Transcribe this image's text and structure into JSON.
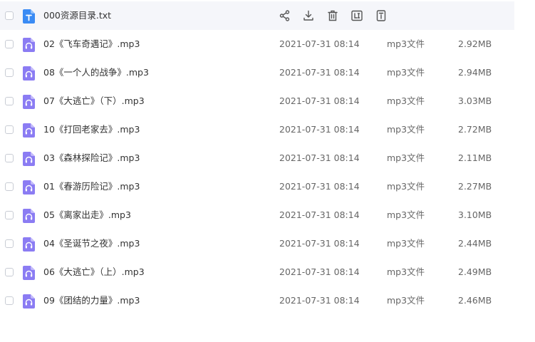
{
  "files": [
    {
      "name": "000资源目录.txt",
      "icon": "txt-file-icon"
    },
    {
      "name": "02《飞车奇遇记》.mp3",
      "date": "2021-07-31 08:14",
      "type": "mp3文件",
      "size": "2.92MB",
      "icon": "audio-file-icon"
    },
    {
      "name": "08《一个人的战争》.mp3",
      "date": "2021-07-31 08:14",
      "type": "mp3文件",
      "size": "2.94MB",
      "icon": "audio-file-icon"
    },
    {
      "name": "07《大逃亡》（下）.mp3",
      "date": "2021-07-31 08:14",
      "type": "mp3文件",
      "size": "3.03MB",
      "icon": "audio-file-icon"
    },
    {
      "name": "10《打回老家去》.mp3",
      "date": "2021-07-31 08:14",
      "type": "mp3文件",
      "size": "2.72MB",
      "icon": "audio-file-icon"
    },
    {
      "name": "03《森林探险记》.mp3",
      "date": "2021-07-31 08:14",
      "type": "mp3文件",
      "size": "2.11MB",
      "icon": "audio-file-icon"
    },
    {
      "name": "01《春游历险记》.mp3",
      "date": "2021-07-31 08:14",
      "type": "mp3文件",
      "size": "2.27MB",
      "icon": "audio-file-icon"
    },
    {
      "name": "05《离家出走》.mp3",
      "date": "2021-07-31 08:14",
      "type": "mp3文件",
      "size": "3.10MB",
      "icon": "audio-file-icon"
    },
    {
      "name": "04《圣诞节之夜》.mp3",
      "date": "2021-07-31 08:14",
      "type": "mp3文件",
      "size": "2.44MB",
      "icon": "audio-file-icon"
    },
    {
      "name": "06《大逃亡》（上）.mp3",
      "date": "2021-07-31 08:14",
      "type": "mp3文件",
      "size": "2.49MB",
      "icon": "audio-file-icon"
    },
    {
      "name": "09《团结的力量》.mp3",
      "date": "2021-07-31 08:14",
      "type": "mp3文件",
      "size": "2.46MB",
      "icon": "audio-file-icon"
    }
  ],
  "hover_actions": [
    "share-icon",
    "download-icon",
    "delete-icon",
    "rename-icon",
    "info-icon"
  ],
  "colors": {
    "txt_icon": "#3a8bf4",
    "audio_icon": "#8b7cf3",
    "hover_row": "#f5f6fa",
    "action_icon": "#555555",
    "checkbox_border": "#c8ccd4"
  }
}
